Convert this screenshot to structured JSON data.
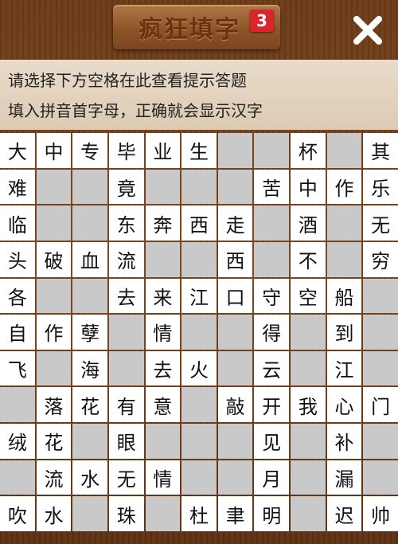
{
  "header": {
    "title": "疯狂填字",
    "level": "3",
    "close_icon": "close-icon"
  },
  "hints": {
    "line1": "请选择下方空格在此查看提示答题",
    "line2": "填入拼音首字母，正确就会显示汉字"
  },
  "grid": {
    "legend": {
      "_": "blank white cell",
      "#": "wood (no cell)",
      "=": "blank grey cell"
    },
    "rows": [
      [
        "大",
        "中",
        "专",
        "毕",
        "业",
        "生",
        "=",
        "=",
        "杯",
        "=",
        "其"
      ],
      [
        "难",
        "=",
        "=",
        "竟",
        "=",
        "=",
        "=",
        "苦",
        "中",
        "作",
        "乐"
      ],
      [
        "临",
        "=",
        "=",
        "东",
        "奔",
        "西",
        "走",
        "=",
        "酒",
        "=",
        "无"
      ],
      [
        "头",
        "破",
        "血",
        "流",
        "=",
        "=",
        "西",
        "=",
        "不",
        "=",
        "穷"
      ],
      [
        "各",
        "=",
        "=",
        "去",
        "来",
        "江",
        "口",
        "守",
        "空",
        "船",
        "="
      ],
      [
        "自",
        "作",
        "孽",
        "=",
        "情",
        "=",
        "=",
        "得",
        "=",
        "到",
        "="
      ],
      [
        "飞",
        "=",
        "海",
        "=",
        "去",
        "火",
        "=",
        "云",
        "=",
        "江",
        "="
      ],
      [
        "=",
        "落",
        "花",
        "有",
        "意",
        "=",
        "敲",
        "开",
        "我",
        "心",
        "门"
      ],
      [
        "绒",
        "花",
        "=",
        "眼",
        "=",
        "=",
        "=",
        "见",
        "=",
        "补",
        "="
      ],
      [
        "=",
        "流",
        "水",
        "无",
        "情",
        "=",
        "=",
        "月",
        "=",
        "漏",
        "="
      ],
      [
        "吹",
        "水",
        "=",
        "珠",
        "=",
        "杜",
        "聿",
        "明",
        "=",
        "迟",
        "帅"
      ]
    ]
  }
}
